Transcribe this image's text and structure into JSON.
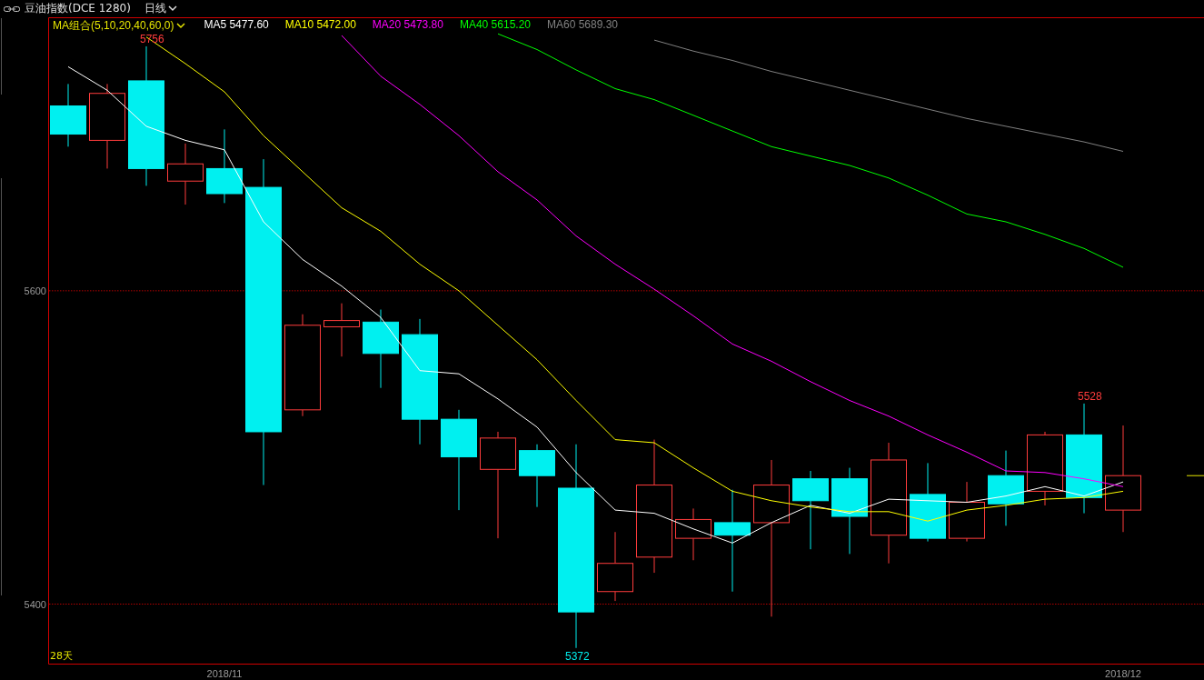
{
  "header": {
    "title": "豆油指数(DCE 1280)",
    "period": "日线"
  },
  "chart": {
    "legend_title": "MA组合(5,10,20,40,60,0)",
    "period_label": "28天",
    "legend": [
      {
        "value": "5477.60"
      },
      {
        "value": "5472.00"
      },
      {
        "value": "5473.80"
      },
      {
        "value": "5615.20"
      },
      {
        "value": "5689.30"
      }
    ],
    "chart_data": {
      "type": "line",
      "categories": [
        null,
        null,
        null,
        null,
        "2018/11",
        null,
        null,
        null,
        null,
        null,
        null,
        null,
        null,
        null,
        null,
        null,
        null,
        null,
        null,
        null,
        null,
        null,
        null,
        null,
        null,
        null,
        null,
        "2018/12"
      ],
      "ylim": [
        5362,
        5774
      ],
      "yticks": [
        5400,
        5600
      ],
      "series": [
        {
          "name": "MA5",
          "color": "#ffffff",
          "values": [
            5743,
            5728,
            5705,
            5696,
            5690,
            5644,
            5620,
            5603,
            5583,
            5549,
            5547,
            5531,
            5513,
            5484,
            5460,
            5458,
            5448,
            5439,
            5452,
            5463,
            5458,
            5467,
            5466,
            5465,
            5469,
            5475,
            5469,
            5478
          ]
        },
        {
          "name": "MA10",
          "color": "#ffff00",
          "values": [
            null,
            null,
            5762,
            5745,
            5727,
            5699,
            5676,
            5653,
            5638,
            5617,
            5600,
            5578,
            5556,
            5530,
            5505,
            5503,
            5487,
            5472,
            5466,
            5462,
            5459,
            5459,
            5453,
            5460,
            5463,
            5467,
            5468,
            5472
          ]
        },
        {
          "name": "MA20",
          "color": "#ff00ff",
          "values": [
            null,
            null,
            null,
            null,
            null,
            null,
            null,
            5763,
            5737,
            5719,
            5699,
            5676,
            5658,
            5635,
            5617,
            5601,
            5584,
            5566,
            5555,
            5542,
            5530,
            5520,
            5508,
            5497,
            5485,
            5484,
            5480,
            5475
          ]
        },
        {
          "name": "MA40",
          "color": "#00ff00",
          "values": [
            null,
            null,
            null,
            null,
            null,
            null,
            null,
            null,
            null,
            null,
            null,
            5764,
            5754,
            5741,
            5729,
            5722,
            5712,
            5702,
            5692,
            5686,
            5680,
            5672,
            5661,
            5649,
            5644,
            5636,
            5627,
            5615
          ]
        },
        {
          "name": "MA60",
          "color": "#808080",
          "values": [
            null,
            null,
            null,
            null,
            null,
            null,
            null,
            null,
            null,
            null,
            null,
            null,
            null,
            null,
            null,
            5760,
            5753,
            5747,
            5740,
            5734,
            5728,
            5722,
            5716,
            5710,
            5705,
            5700,
            5695,
            5689
          ]
        }
      ],
      "annotations": [
        "5756",
        "5528",
        "5372"
      ]
    }
  }
}
